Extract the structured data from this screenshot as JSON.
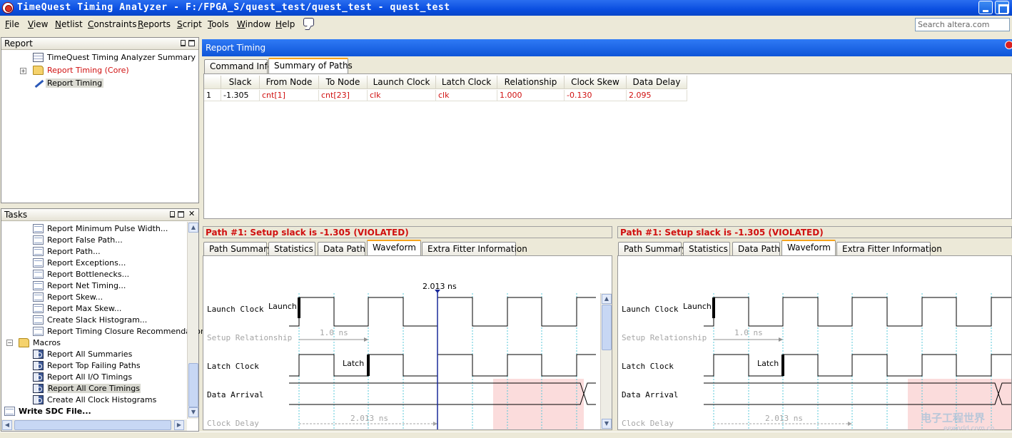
{
  "window": {
    "title": "TimeQuest Timing Analyzer - F:/FPGA_S/quest_test/quest_test - quest_test"
  },
  "menu": [
    "File",
    "View",
    "Netlist",
    "Constraints",
    "Reports",
    "Script",
    "Tools",
    "Window",
    "Help"
  ],
  "search": {
    "placeholder": "Search altera.com"
  },
  "report_panel": {
    "title": "Report",
    "items": [
      {
        "label": "TimeQuest Timing Analyzer Summary",
        "color": "#000000",
        "icon": "table-icon"
      },
      {
        "label": "Report Timing (Core)",
        "color": "#d01010",
        "icon": "folder-icon"
      },
      {
        "label": "Report Timing",
        "color": "#000000",
        "icon": "timing-icon"
      }
    ]
  },
  "tasks_panel": {
    "title": "Tasks",
    "items": [
      {
        "label": "Report Minimum Pulse Width..."
      },
      {
        "label": "Report False Path..."
      },
      {
        "label": "Report Path..."
      },
      {
        "label": "Report Exceptions..."
      },
      {
        "label": "Report Bottlenecks..."
      },
      {
        "label": "Report Net Timing..."
      },
      {
        "label": "Report Skew..."
      },
      {
        "label": "Report Max Skew..."
      },
      {
        "label": "Create Slack Histogram..."
      },
      {
        "label": "Report Timing Closure Recommendations"
      }
    ],
    "macros_label": "Macros",
    "macros": [
      {
        "label": "Report All Summaries"
      },
      {
        "label": "Report Top Failing Paths"
      },
      {
        "label": "Report All I/O Timings"
      },
      {
        "label": "Report All Core Timings"
      },
      {
        "label": "Create All Clock Histograms"
      }
    ],
    "write_sdc": "Write SDC File..."
  },
  "report_timing": {
    "title": "Report Timing",
    "tabs": [
      "Command Info",
      "Summary of Paths"
    ],
    "columns": [
      "",
      "Slack",
      "From Node",
      "To Node",
      "Launch Clock",
      "Latch Clock",
      "Relationship",
      "Clock Skew",
      "Data Delay"
    ],
    "rows": [
      [
        "1",
        "-1.305",
        "cnt[1]",
        "cnt[23]",
        "clk",
        "clk",
        "1.000",
        "-0.130",
        "2.095"
      ]
    ]
  },
  "path_panes": [
    {
      "title": "Path #1: Setup slack is -1.305 (VIOLATED)",
      "tabs": [
        "Path Summary",
        "Statistics",
        "Data Path",
        "Waveform",
        "Extra Fitter Information"
      ],
      "marker_label": "2.013 ns",
      "signals": [
        "Launch Clock",
        "Setup Relationship",
        "Latch Clock",
        "Data Arrival",
        "Clock Delay"
      ],
      "launch_tag": "Launch",
      "latch_tag": "Latch",
      "relationship_value": "1.0 ns",
      "clock_delay_value": "2.013 ns"
    },
    {
      "title": "Path #1: Setup slack is -1.305 (VIOLATED)",
      "tabs": [
        "Path Summary",
        "Statistics",
        "Data Path",
        "Waveform",
        "Extra Fitter Information"
      ],
      "signals": [
        "Launch Clock",
        "Setup Relationship",
        "Latch Clock",
        "Data Arrival",
        "Clock Delay"
      ],
      "launch_tag": "Launch",
      "latch_tag": "Latch",
      "relationship_value": "1.0 ns",
      "clock_delay_value": "2.013 ns"
    }
  ],
  "watermark": {
    "text": "电子工程世界",
    "sub": "eeworld.com.cn"
  },
  "colors": {
    "violation": "#d01010",
    "title_blue": "#0a4ee0",
    "active_tab": "#f7a41c",
    "slack_region": "#fbdcdc"
  }
}
